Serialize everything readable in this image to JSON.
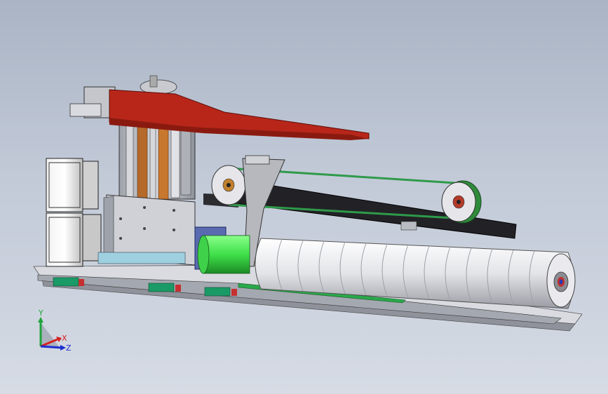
{
  "triad": {
    "y_label": "Y",
    "x_label": "X",
    "z_label": "Z",
    "colors": {
      "y": "#1fa33a",
      "x": "#d42020",
      "z": "#1e2fd0"
    }
  },
  "model": {
    "colors": {
      "arm": "#b8261a",
      "arm_dark": "#8a1a10",
      "roller": "#e6e6ea",
      "green": "#3fe04a",
      "rail": "#1a8a5a",
      "frame": "#2a2a2e",
      "steel": "#b9bcc2",
      "bronze": "#c8722a"
    }
  }
}
